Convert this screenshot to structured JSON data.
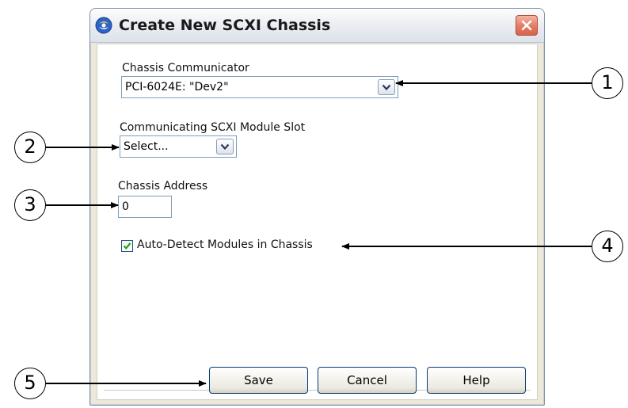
{
  "window": {
    "title": "Create New SCXI Chassis",
    "icons": {
      "app": "app-logo-icon",
      "close": "close-icon"
    }
  },
  "form": {
    "chassis_communicator": {
      "label": "Chassis Communicator",
      "value": "PCI-6024E: \"Dev2\""
    },
    "module_slot": {
      "label": "Communicating SCXI Module Slot",
      "value": "Select..."
    },
    "chassis_address": {
      "label": "Chassis Address",
      "value": "0"
    },
    "auto_detect": {
      "label": "Auto-Detect Modules in Chassis",
      "checked": true
    }
  },
  "buttons": {
    "save": "Save",
    "cancel": "Cancel",
    "help": "Help"
  },
  "callouts": [
    "1",
    "2",
    "3",
    "4",
    "5"
  ],
  "colors": {
    "dialog_bg": "#ece9d8",
    "field_border": "#7f9db9",
    "close_button": "#e27b63",
    "checkmark": "#21a121"
  }
}
